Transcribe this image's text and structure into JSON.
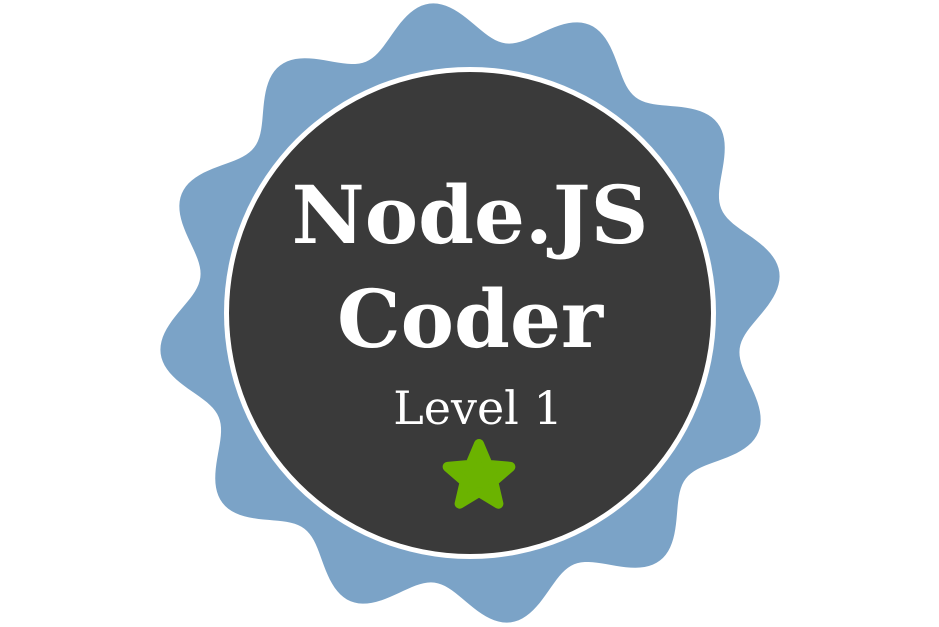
{
  "badge": {
    "title_line_1": "Node.JS",
    "title_line_2": "Coder",
    "level_text": "Level 1",
    "icon": "star-icon"
  },
  "colors": {
    "background": "#ffffff",
    "scalloped_border": "#7ba3c7",
    "inner_ring": "#ffffff",
    "disc": "#3a3a3a",
    "text": "#ffffff",
    "star": "#6bb300"
  }
}
